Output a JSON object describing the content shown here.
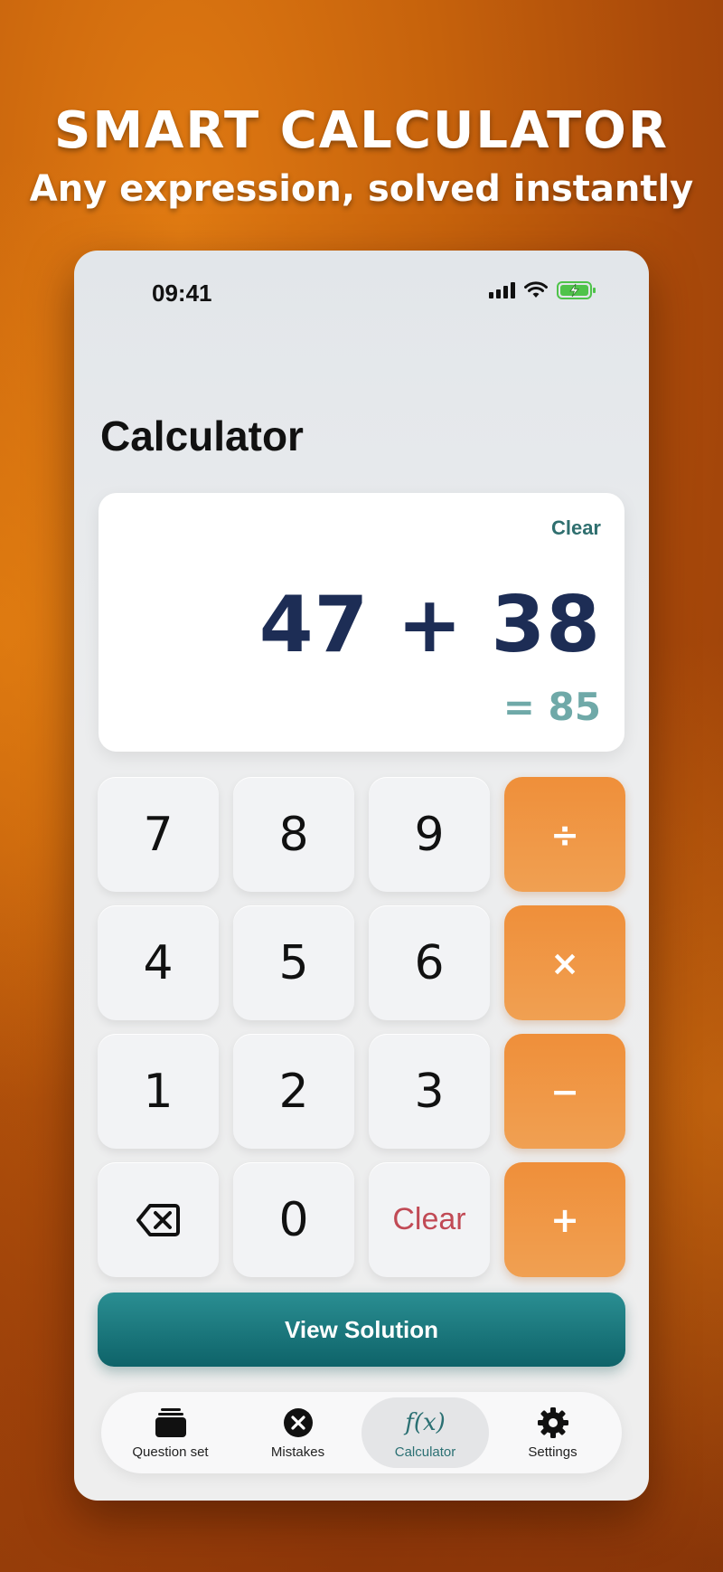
{
  "promo": {
    "title": "SMART CALCULATOR",
    "subtitle": "Any expression, solved instantly"
  },
  "status_bar": {
    "time": "09:41",
    "icons": [
      "cellular-signal-icon",
      "wifi-icon",
      "battery-charging-icon"
    ]
  },
  "page": {
    "title": "Calculator"
  },
  "display": {
    "clear_label": "Clear",
    "expression": "47 + 38",
    "result": "= 85"
  },
  "keypad": {
    "rows": [
      [
        "7",
        "8",
        "9",
        "÷"
      ],
      [
        "4",
        "5",
        "6",
        "×"
      ],
      [
        "1",
        "2",
        "3",
        "−"
      ],
      [
        "backspace",
        "0",
        "Clear",
        "+"
      ]
    ],
    "clear_label": "Clear"
  },
  "actions": {
    "view_solution": "View Solution"
  },
  "tabbar": {
    "tabs": [
      {
        "label": "Question set",
        "icon": "stack-icon",
        "active": false
      },
      {
        "label": "Mistakes",
        "icon": "x-circle-icon",
        "active": false
      },
      {
        "label": "Calculator",
        "icon": "fx-icon",
        "icon_text": "f(x)",
        "active": true
      },
      {
        "label": "Settings",
        "icon": "gear-icon",
        "active": false
      }
    ]
  },
  "colors": {
    "accent_teal": "#0e6369",
    "operator_orange": "#ef8f3a",
    "expression_navy": "#1d2d55",
    "result_teal": "#6fa9a8",
    "clear_red": "#c14a55"
  }
}
